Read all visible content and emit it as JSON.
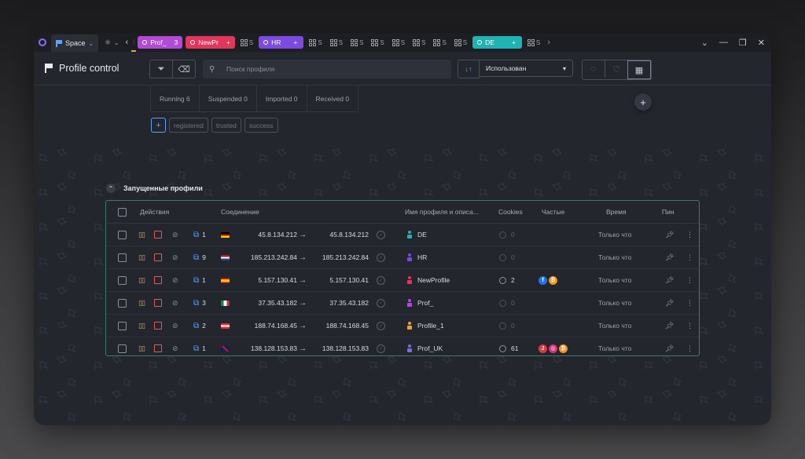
{
  "tabbar": {
    "space_label": "Space",
    "tabs": [
      {
        "label": "Prof_",
        "badge": "3",
        "color": "#b24ad6"
      },
      {
        "label": "NewPr",
        "badge": "+",
        "color": "#e0375b"
      },
      {
        "label": "HR",
        "badge": "+",
        "color": "#7c4ae0"
      },
      {
        "label": "DE",
        "badge": "+",
        "color": "#1fb3b3"
      }
    ],
    "grid_suffix": "S"
  },
  "toolbar": {
    "title": "Profile control",
    "search_placeholder": "Поиск профиля",
    "sort_selected": "Использован"
  },
  "status_tabs": [
    {
      "label": "Running 6"
    },
    {
      "label": "Suspended 0"
    },
    {
      "label": "Imported 0"
    },
    {
      "label": "Received 0"
    }
  ],
  "tags": [
    "registered",
    "trusted",
    "success"
  ],
  "section": {
    "title": "Запущенные профили"
  },
  "table": {
    "headers": {
      "actions": "Действия",
      "connection": "Соединение",
      "name": "Имя профиля и описа...",
      "cookies": "Cookies",
      "frequent": "Частые",
      "time": "Время",
      "pin": "Пин"
    },
    "rows": [
      {
        "count": "1",
        "flag": "de",
        "ip_from": "45.8.134.212",
        "ip_to": "45.8.134.212",
        "name": "DE",
        "person_color": "#1fb3b3",
        "cookies": "0",
        "cookies_active": false,
        "sites": [],
        "time": "Только что"
      },
      {
        "count": "9",
        "flag": "nl",
        "ip_from": "185.213.242.84",
        "ip_to": "185.213.242.84",
        "name": "HR",
        "person_color": "#7c4ae0",
        "cookies": "0",
        "cookies_active": false,
        "sites": [],
        "time": "Только что"
      },
      {
        "count": "1",
        "flag": "es",
        "ip_from": "5.157.130.41",
        "ip_to": "5.157.130.41",
        "name": "NewProfile",
        "person_color": "#e0375b",
        "cookies": "2",
        "cookies_active": true,
        "sites": [
          {
            "icon": "facebook-icon",
            "glyph": "f",
            "color": "#1877f2"
          },
          {
            "icon": "bitcoin-icon",
            "glyph": "₿",
            "color": "#f7931a"
          }
        ],
        "time": "Только что"
      },
      {
        "count": "3",
        "flag": "it",
        "ip_from": "37.35.43.182",
        "ip_to": "37.35.43.182",
        "name": "Prof_",
        "person_color": "#b24ad6",
        "cookies": "0",
        "cookies_active": false,
        "sites": [],
        "time": "Только что"
      },
      {
        "count": "2",
        "flag": "at",
        "ip_from": "188.74.168.45",
        "ip_to": "188.74.168.45",
        "name": "Profile_1",
        "person_color": "#e9a23b",
        "cookies": "0",
        "cookies_active": false,
        "sites": [],
        "time": "Только что"
      },
      {
        "count": "1",
        "flag": "uk",
        "ip_from": "138.128.153.83",
        "ip_to": "138.128.153.83",
        "name": "Prof_UK",
        "person_color": "#7c6cd6",
        "cookies": "61",
        "cookies_active": true,
        "sites": [
          {
            "icon": "java-icon",
            "glyph": "J",
            "color": "#e03a3a"
          },
          {
            "icon": "instagram-icon",
            "glyph": "◎",
            "color": "#d6357a"
          },
          {
            "icon": "bitcoin-icon",
            "glyph": "₿",
            "color": "#f7931a"
          }
        ],
        "time": "Только что"
      }
    ]
  }
}
